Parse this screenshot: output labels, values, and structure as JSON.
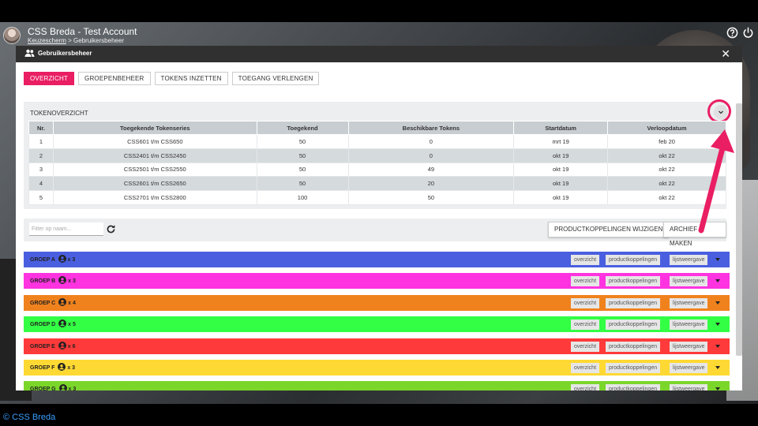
{
  "app": {
    "title": "CSS Breda - Test Account",
    "breadcrumb_link": "Keuzescherm",
    "breadcrumb_rest": " > Gebruikersbeheer"
  },
  "modal": {
    "title": "Gebruikersbeheer",
    "close": "✕"
  },
  "tabs": [
    {
      "label": "OVERZICHT",
      "active": true
    },
    {
      "label": "GROEPENBEHEER",
      "active": false
    },
    {
      "label": "TOKENS INZETTEN",
      "active": false
    },
    {
      "label": "TOEGANG VERLENGEN",
      "active": false
    }
  ],
  "token_panel": {
    "title": "TOKENOVERZICHT",
    "columns": [
      "Nr.",
      "Toegekende Tokenseries",
      "Toegekend",
      "Beschikbare Tokens",
      "Startdatum",
      "Verloopdatum"
    ],
    "rows": [
      [
        "1",
        "CSS601 t/m CSS650",
        "50",
        "0",
        "mrt 19",
        "feb 20"
      ],
      [
        "2",
        "CSS2401 t/m CSS2450",
        "50",
        "0",
        "okt 19",
        "okt 22"
      ],
      [
        "3",
        "CSS2501 t/m CSS2550",
        "50",
        "49",
        "okt 19",
        "okt 22"
      ],
      [
        "4",
        "CSS2601 t/m CSS2650",
        "50",
        "20",
        "okt 19",
        "okt 22"
      ],
      [
        "5",
        "CSS2701 t/m CSS2800",
        "100",
        "50",
        "okt 19",
        "okt 22"
      ]
    ]
  },
  "filter": {
    "placeholder": "Filter op naam...",
    "product_button": "PRODUCTKOPPELINGEN WIJZIGEN",
    "archive_button": "ARCHIEF MAKEN"
  },
  "groups": [
    {
      "name": "GROEP A",
      "count": "x 3",
      "color": "#4a5fe0"
    },
    {
      "name": "GROEP B",
      "count": "x 3",
      "color": "#ff33e0"
    },
    {
      "name": "GROEP C",
      "count": "x 4",
      "color": "#f0821e"
    },
    {
      "name": "GROEP D",
      "count": "x 5",
      "color": "#33ff44"
    },
    {
      "name": "GROEP E",
      "count": "x 6",
      "color": "#ff3a3a"
    },
    {
      "name": "GROEP F",
      "count": "x 3",
      "color": "#ffd933"
    },
    {
      "name": "GROEP G",
      "count": "x 3",
      "color": "#7bd62a"
    }
  ],
  "group_actions": [
    "overzicht",
    "productkoppelingen",
    "lijstweergave"
  ],
  "footer": "© CSS Breda",
  "accent_color": "#e91e63"
}
